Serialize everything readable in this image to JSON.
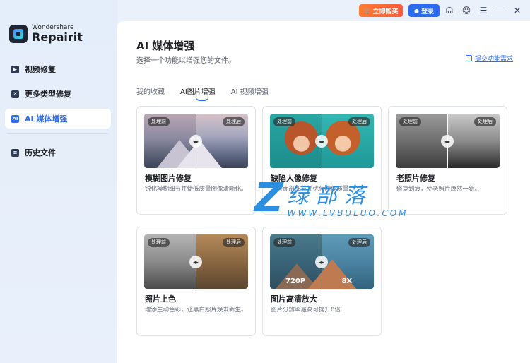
{
  "app": {
    "brand_small": "Wondershare",
    "brand_big": "Repairit"
  },
  "topbar": {
    "buy_label": "立即购买",
    "login_label": "登录",
    "icons": [
      "headset-icon",
      "chat-icon",
      "menu-icon",
      "minimize-icon",
      "close-icon"
    ]
  },
  "sidebar": {
    "items": [
      {
        "label": "视频修复",
        "icon": "play-icon"
      },
      {
        "label": "更多类型修复",
        "icon": "wrench-icon"
      },
      {
        "label": "AI 媒体增强",
        "icon": "ai-icon",
        "active": true
      },
      {
        "label": "历史文件",
        "icon": "document-icon"
      }
    ]
  },
  "main": {
    "title": "AI 媒体增强",
    "subtitle": "选择一个功能以增强您的文件。",
    "feedback_label": "提交功能需求",
    "tabs": [
      {
        "label": "我的收藏"
      },
      {
        "label": "AI图片增强",
        "active": true
      },
      {
        "label": "AI 视频增强"
      }
    ],
    "before_label": "处理前",
    "after_label": "处理后",
    "cards": [
      {
        "title": "模糊图片修复",
        "desc": "锐化模糊细节并使低质量图像清晰化。"
      },
      {
        "title": "缺陷人像修复",
        "desc": "完善面部细节并优化图像质量。"
      },
      {
        "title": "老照片修复",
        "desc": "修复划痕，使老照片焕然一新。"
      },
      {
        "title": "照片上色",
        "desc": "增添生动色彩，让黑白照片焕发新生。"
      },
      {
        "title": "图片高清放大",
        "desc": "图片分辨率最高可提升8倍",
        "before_res": "720P",
        "after_res": "8X"
      }
    ]
  },
  "watermark": {
    "mark": "Z",
    "cn": "绿部落",
    "en": "WWW.LVBULUO.COM"
  }
}
